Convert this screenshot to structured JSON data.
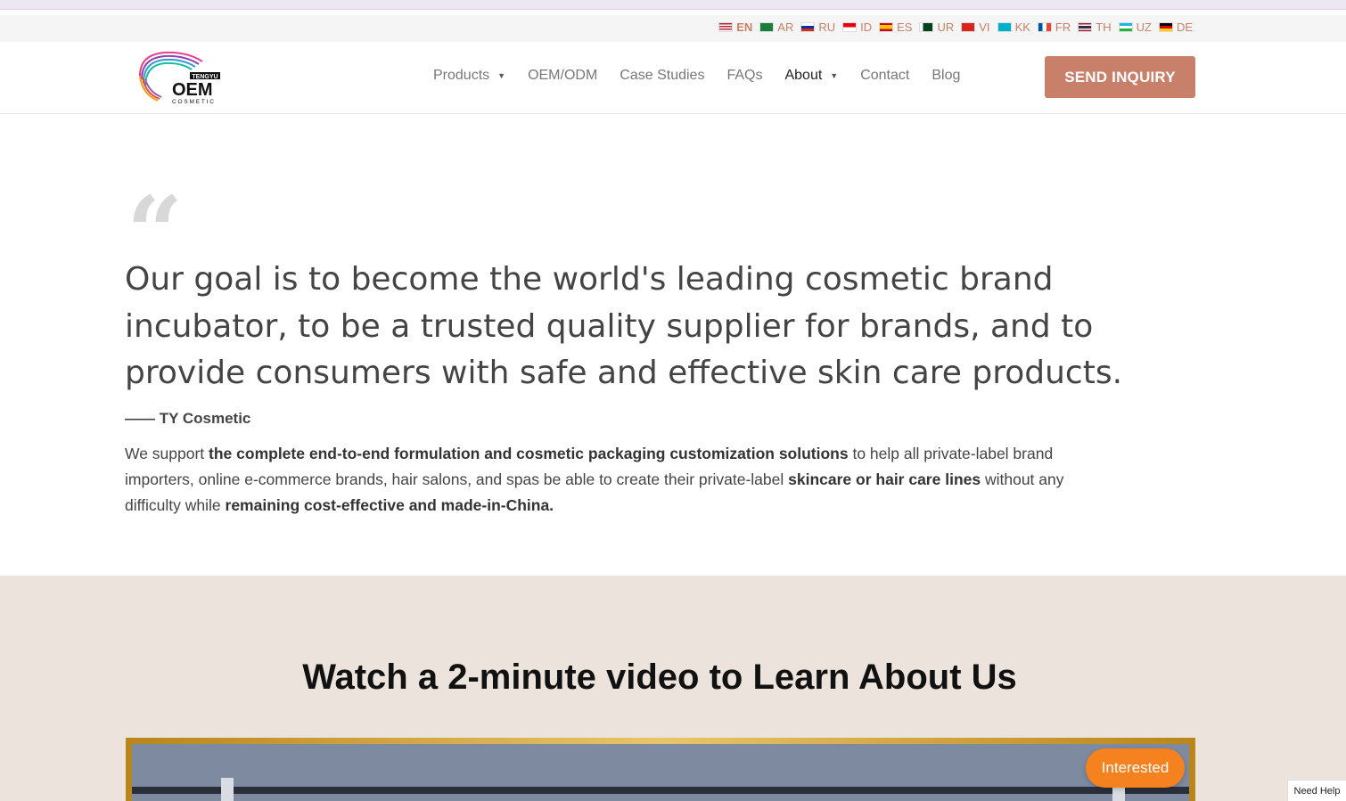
{
  "languages": [
    {
      "code": "EN",
      "active": true
    },
    {
      "code": "AR"
    },
    {
      "code": "RU"
    },
    {
      "code": "ID"
    },
    {
      "code": "ES"
    },
    {
      "code": "UR"
    },
    {
      "code": "VI"
    },
    {
      "code": "KK"
    },
    {
      "code": "FR"
    },
    {
      "code": "TH"
    },
    {
      "code": "UZ"
    },
    {
      "code": "DE"
    }
  ],
  "logo": {
    "top_text": "TENGYU",
    "main_text": "OEM",
    "sub_text": "COSMETIC"
  },
  "nav": {
    "items": [
      {
        "label": "Products",
        "has_dropdown": true
      },
      {
        "label": "OEM/ODM"
      },
      {
        "label": "Case Studies"
      },
      {
        "label": "FAQs"
      },
      {
        "label": "About",
        "has_dropdown": true,
        "current": true
      },
      {
        "label": "Contact"
      },
      {
        "label": "Blog"
      }
    ],
    "cta_label": "SEND INQUIRY"
  },
  "quote": {
    "mark": "“",
    "text": "Our goal is to become the world's leading cosmetic brand incubator, to be a trusted quality supplier for brands, and to provide consumers with safe and effective skin care products.",
    "author": "—— TY Cosmetic"
  },
  "support": {
    "p1": "We support ",
    "b1": "the complete end-to-end formulation and cosmetic packaging customization solutions",
    "p2": " to help all private-label brand importers, online e-commerce brands, hair salons, and spas be able to create their private-label ",
    "b2": "skincare or hair care lines",
    "p3": " without any difficulty while ",
    "b3": "remaining cost-effective and made-in-China."
  },
  "video": {
    "title": "Watch a 2-minute video to Learn About Us"
  },
  "floating": {
    "interested_label": "Interested",
    "help_label": "Need Help"
  },
  "colors": {
    "accent": "#c8806a",
    "orange": "#f5821f",
    "beige": "#ece4dc"
  }
}
